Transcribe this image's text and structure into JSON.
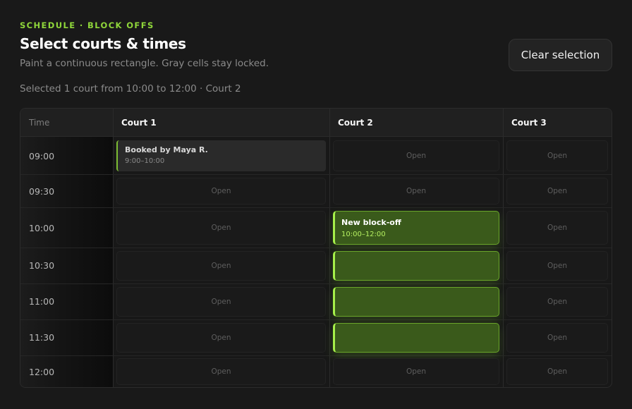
{
  "header": {
    "eyebrow": "SCHEDULE · BLOCK OFFS",
    "title": "Select courts & times",
    "subtitle": "Paint a continuous rectangle. Gray cells stay locked.",
    "status": "Selected 1 court from 10:00 to 12:00 · Court 2",
    "clear_button": "Clear selection"
  },
  "grid": {
    "time_header": "Time",
    "courts": [
      "Court 1",
      "Court 2",
      "Court 3"
    ],
    "times": [
      "09:00",
      "09:30",
      "10:00",
      "10:30",
      "11:00",
      "11:30",
      "12:00"
    ],
    "open_label": "Open",
    "booking": {
      "title": "Booked by Maya R.",
      "time": "9:00–10:00",
      "court": "Court 1"
    },
    "selection": {
      "title": "New block-off",
      "time": "10:00–12:00",
      "court": "Court 2"
    }
  },
  "colors": {
    "accent": "#8fd63a",
    "selection_fill": "#3a5a1b",
    "background": "#191919"
  }
}
